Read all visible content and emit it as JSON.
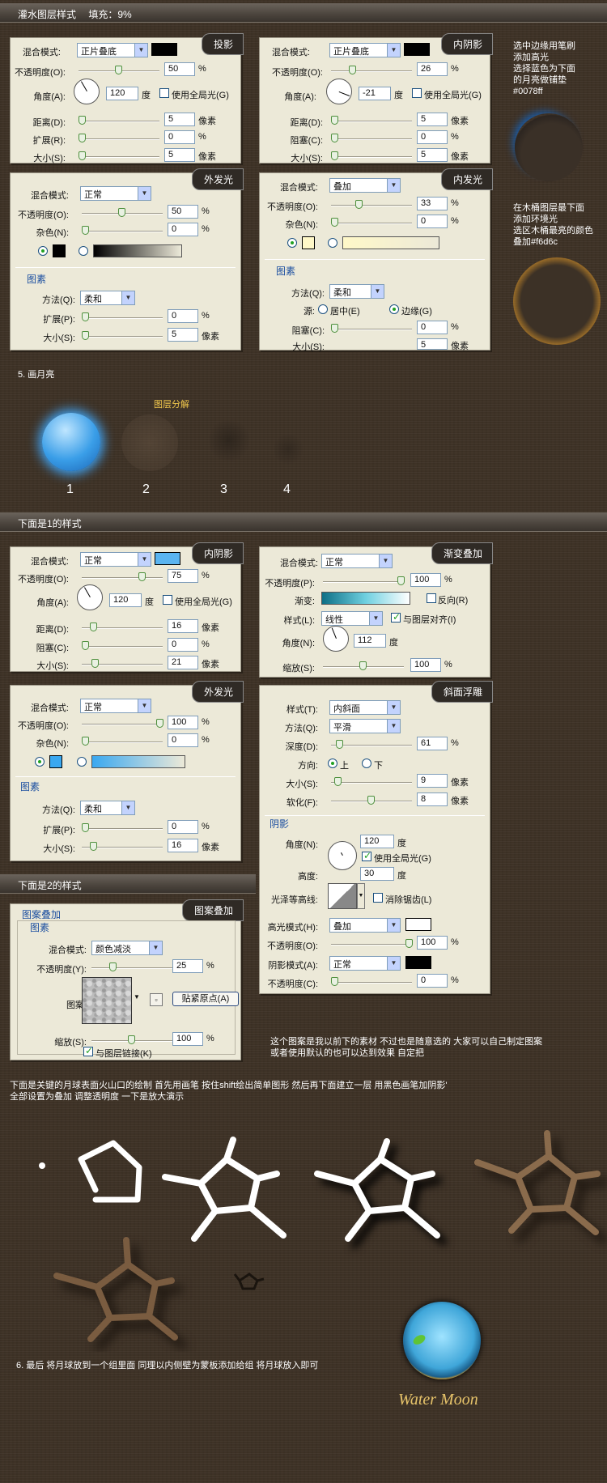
{
  "title_bar": "灌水图层样式　 填充：9%",
  "p1": {
    "tab": "投影",
    "blend_label": "混合模式:",
    "blend": "正片叠底",
    "color": "#000000",
    "opacity_label": "不透明度(O):",
    "opacity": "50",
    "angle_label": "角度(A):",
    "angle": "120",
    "deg": "度",
    "global": "使用全局光(G)",
    "dist_label": "距离(D):",
    "dist": "5",
    "spread_label": "扩展(R):",
    "spread": "0",
    "size_label": "大小(S):",
    "size": "5",
    "px": "像素",
    "pct": "%"
  },
  "p2": {
    "tab": "内阴影",
    "blend_label": "混合模式:",
    "blend": "正片叠底",
    "color": "#000000",
    "opacity_label": "不透明度(O):",
    "opacity": "26",
    "angle_label": "角度(A):",
    "angle": "-21",
    "deg": "度",
    "global": "使用全局光(G)",
    "dist_label": "距离(D):",
    "dist": "5",
    "choke_label": "阻塞(C):",
    "choke": "0",
    "size_label": "大小(S):",
    "size": "5",
    "px": "像素",
    "pct": "%"
  },
  "note1": [
    "选中边缘用笔刷",
    "添加高光",
    "选择蓝色为下面",
    "的月亮做铺垫",
    "#0078ff"
  ],
  "p3": {
    "tab": "外发光",
    "blend_label": "混合模式:",
    "blend": "正常",
    "opacity_label": "不透明度(O):",
    "opacity": "50",
    "noise_label": "杂色(N):",
    "noise": "0",
    "section": "图素",
    "method_label": "方法(Q):",
    "method": "柔和",
    "spread_label": "扩展(P):",
    "spread": "0",
    "size_label": "大小(S):",
    "size": "5",
    "px": "像素",
    "pct": "%",
    "color": "#000000"
  },
  "p4": {
    "tab": "内发光",
    "blend_label": "混合模式:",
    "blend": "叠加",
    "opacity_label": "不透明度(O):",
    "opacity": "33",
    "noise_label": "杂色(N):",
    "noise": "0",
    "section": "图素",
    "method_label": "方法(Q):",
    "method": "柔和",
    "source_label": "源:",
    "center": "居中(E)",
    "edge": "边缘(G)",
    "choke_label": "阻塞(C):",
    "choke": "0",
    "size_label": "大小(S):",
    "size": "5",
    "px": "像素",
    "pct": "%",
    "color": "#fff8c8"
  },
  "note2": [
    "在木桶图层最下面",
    "添加环境光",
    "选区木桶最亮的颜色",
    "叠加#f6d6c"
  ],
  "step5": "5. 画月亮",
  "layer_split": "图层分解",
  "nums": [
    "1",
    "2",
    "3",
    "4"
  ],
  "bar2": "下面是1的样式",
  "p5": {
    "tab": "内阴影",
    "blend_label": "混合模式:",
    "blend": "正常",
    "color": "#5ab4f0",
    "opacity_label": "不透明度(O):",
    "opacity": "75",
    "angle_label": "角度(A):",
    "angle": "120",
    "deg": "度",
    "global": "使用全局光(G)",
    "dist_label": "距离(D):",
    "dist": "16",
    "choke_label": "阻塞(C):",
    "choke": "0",
    "size_label": "大小(S):",
    "size": "21",
    "px": "像素",
    "pct": "%"
  },
  "p6": {
    "tab": "渐变叠加",
    "blend_label": "混合模式:",
    "blend": "正常",
    "opacity_label": "不透明度(P):",
    "opacity": "100",
    "grad_label": "渐变:",
    "reverse": "反向(R)",
    "style_label": "样式(L):",
    "style": "线性",
    "align": "与图层对齐(I)",
    "angle_label": "角度(N):",
    "angle": "112",
    "deg": "度",
    "scale_label": "缩放(S):",
    "scale": "100",
    "pct": "%"
  },
  "p7": {
    "tab": "外发光",
    "blend_label": "混合模式:",
    "blend": "正常",
    "opacity_label": "不透明度(O):",
    "opacity": "100",
    "noise_label": "杂色(N):",
    "noise": "0",
    "section": "图素",
    "method_label": "方法(Q):",
    "method": "柔和",
    "spread_label": "扩展(P):",
    "spread": "0",
    "size_label": "大小(S):",
    "size": "16",
    "px": "像素",
    "pct": "%",
    "color": "#3aa8f0"
  },
  "p8": {
    "tab": "斜面浮雕",
    "style_label": "样式(T):",
    "style": "内斜面",
    "method_label": "方法(Q):",
    "method": "平滑",
    "depth_label": "深度(D):",
    "depth": "61",
    "dir_label": "方向:",
    "up": "上",
    "down": "下",
    "size_label": "大小(S):",
    "size": "9",
    "soften_label": "软化(F):",
    "soften": "8",
    "px": "像素",
    "pct": "%",
    "section": "阴影",
    "angle_label": "角度(N):",
    "angle": "120",
    "deg": "度",
    "global": "使用全局光(G)",
    "alt_label": "高度:",
    "alt": "30",
    "gloss_label": "光泽等高线:",
    "anti": "消除锯齿(L)",
    "hl_label": "高光模式(H):",
    "hl": "叠加",
    "hl_op": "100",
    "sh_label": "阴影模式(A):",
    "sh": "正常",
    "sh_op": "0",
    "op_label": "不透明度(O):",
    "op2_label": "不透明度(C):"
  },
  "bar3": "下面是2的样式",
  "p9": {
    "tab": "图案叠加",
    "group": "图案叠加",
    "sub": "图素",
    "blend_label": "混合模式:",
    "blend": "颜色减淡",
    "opacity_label": "不透明度(Y):",
    "opacity": "25",
    "pattern_label": "图案:",
    "snap": "贴紧原点(A)",
    "scale_label": "缩放(S):",
    "scale": "100",
    "link": "与图层链接(K)",
    "pct": "%"
  },
  "note3": [
    "这个图案是我以前下的素材  不过也是随意选的  大家可以自己制定图案",
    "或者使用默认的也可以达到效果  自定把"
  ],
  "note4": [
    "下面是关键的月球表面火山口的绘制  首先用画笔  按住shift绘出简单图形  然后再下面建立一层  用黑色画笔加阴影'",
    "  全部设置为叠加  调整透明度  一下是放大演示"
  ],
  "step6": "6. 最后  将月球放到一个组里面  同理以内侧壁为蒙板添加给组  将月球放入即可",
  "logo": "Water Moon"
}
